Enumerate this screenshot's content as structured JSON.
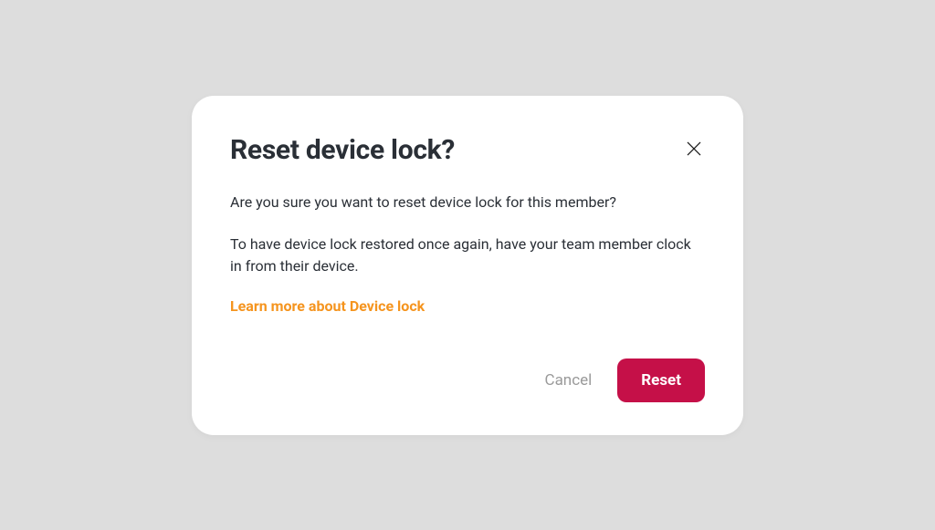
{
  "modal": {
    "title": "Reset device lock?",
    "body_line1": "Are you sure you want to reset device lock for this member?",
    "body_line2": "To have device lock restored once again, have your team member clock in from their device.",
    "learn_more_label": "Learn more about Device lock",
    "cancel_label": "Cancel",
    "reset_label": "Reset"
  }
}
